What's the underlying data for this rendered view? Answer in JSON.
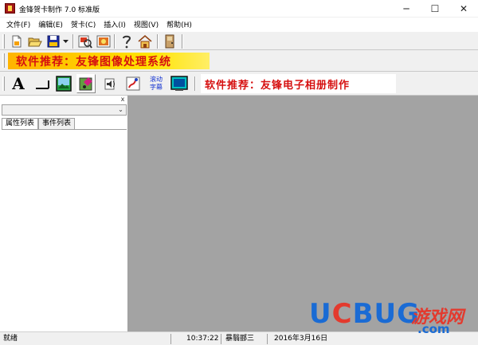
{
  "window": {
    "title": "金锋贺卡制作 7.0 标准版",
    "minimize": "─",
    "maximize": "☐",
    "close": "✕"
  },
  "menu": [
    {
      "label": "文件(F)"
    },
    {
      "label": "编辑(E)"
    },
    {
      "label": "贺卡(C)"
    },
    {
      "label": "插入(I)"
    },
    {
      "label": "视图(V)"
    },
    {
      "label": "帮助(H)"
    }
  ],
  "ad_bar": {
    "text": "软件推荐：友锋图像处理系统"
  },
  "toolbar2": {
    "text_tool": "A",
    "scroll_text_line1": "滚动",
    "scroll_text_line2": "字幕",
    "ad_text": "软件推荐：友锋电子相册制作"
  },
  "left_panel": {
    "close": "x",
    "combo_arrow": "⌄",
    "tabs": [
      {
        "label": "属性列表"
      },
      {
        "label": "事件列表"
      }
    ]
  },
  "statusbar": {
    "state": "就绪",
    "time": "10:37:22",
    "mode": "暴翳郦三",
    "date": "2016年3月16日"
  },
  "watermark": {
    "brand_u": "U",
    "brand_c": "C",
    "brand_b": "B",
    "brand_u2": "U",
    "brand_g": "G",
    "cn": "游戏网",
    "domain": ".com"
  },
  "colors": {
    "ad_red": "#d61010",
    "ad_yellow": "#ffe300",
    "workspace_gray": "#a3a3a3",
    "watermark_blue": "#1a6bd4",
    "watermark_red": "#e33a2e"
  }
}
